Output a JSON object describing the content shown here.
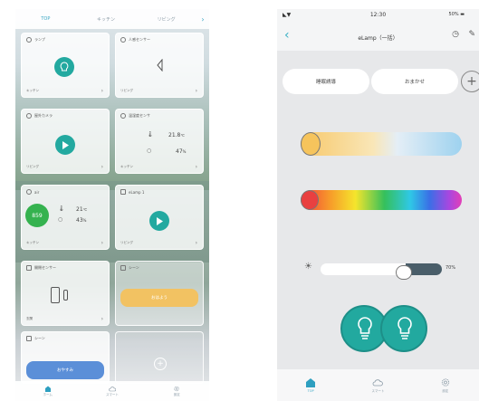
{
  "left": {
    "tabs": [
      "TOP",
      "キッチン",
      "リビング"
    ],
    "cards": {
      "lamp": {
        "title": "ランプ",
        "sub": "キッチン"
      },
      "human": {
        "title": "人感センサー",
        "sub": "リビング"
      },
      "camera": {
        "title": "屋外カメラ",
        "sub": "リビング"
      },
      "temp": {
        "title": "温湿度センサ",
        "temp": "21.8",
        "temp_unit": "℃",
        "hum": "47",
        "hum_unit": "%",
        "sub": "キッチン"
      },
      "air": {
        "title": "air",
        "value": "859",
        "temp": "21",
        "temp_unit": "℃",
        "hum": "43",
        "hum_unit": "%",
        "sub": "キッチン"
      },
      "elamp": {
        "title": "eLamp 1",
        "sub": "リビング"
      },
      "open": {
        "title": "開閉センサー",
        "sub": "玄関"
      },
      "scene1": {
        "title": "シーン",
        "button": "おはよう"
      },
      "scene2": {
        "title": "シーン",
        "button": "おやすみ"
      }
    },
    "nav": [
      "ホーム",
      "スマート",
      "設定"
    ]
  },
  "right": {
    "status": {
      "time": "12:30",
      "battery": "50%"
    },
    "title": "eLamp（一括）",
    "modes": [
      "睡眠誘導",
      "おまかせ"
    ],
    "brightness": "70",
    "brightness_unit": "%",
    "nav": [
      "TOP",
      "スマート",
      "設定"
    ]
  }
}
